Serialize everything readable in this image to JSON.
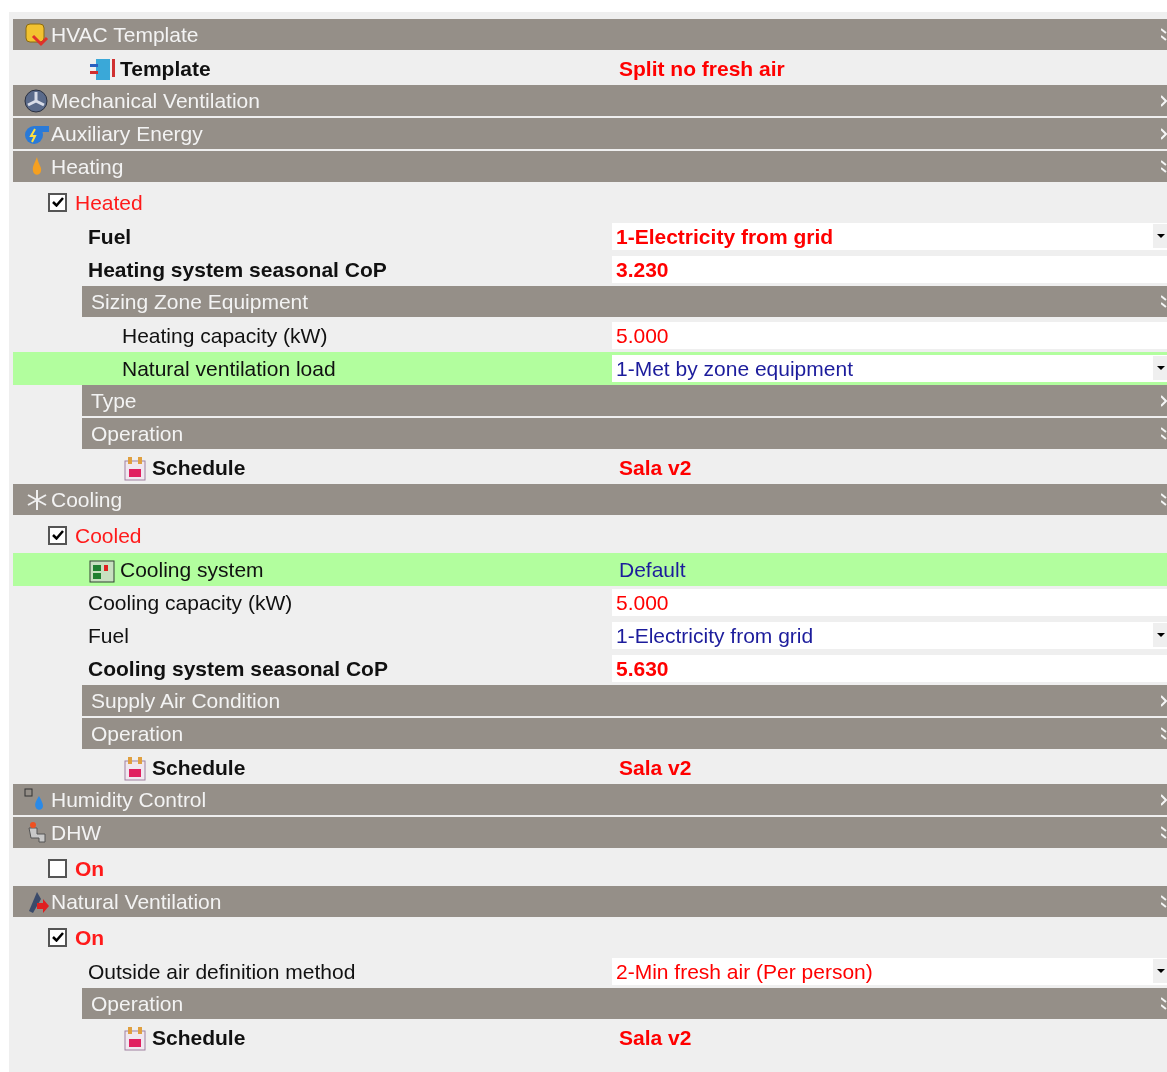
{
  "sections": [
    {
      "title": "HVAC Template",
      "expanded": true,
      "children": [
        {
          "kind": "template",
          "label": "Template",
          "label_bold": true,
          "value": "Split no fresh air",
          "value_bold": true,
          "overridden": true,
          "highlighted": false
        }
      ]
    },
    {
      "title": "Mechanical Ventilation",
      "expanded": false
    },
    {
      "title": "Auxiliary Energy",
      "expanded": false
    },
    {
      "title": "Heating",
      "expanded": true,
      "children": [
        {
          "kind": "checkbox",
          "label": "Heated",
          "checked": true,
          "label_bold": false
        },
        {
          "kind": "dropdown",
          "label": "Fuel",
          "label_bold": true,
          "value": "1-Electricity from grid",
          "value_bold": true,
          "overridden": true,
          "highlighted": false
        },
        {
          "kind": "field",
          "label": "Heating system seasonal CoP",
          "label_bold": true,
          "value": "3.230",
          "value_bold": true,
          "overridden": true,
          "highlighted": false
        },
        {
          "kind": "section",
          "title": "Sizing Zone Equipment",
          "expanded": true,
          "children": [
            {
              "kind": "field",
              "label": "Heating capacity (kW)",
              "label_bold": false,
              "value": "5.000",
              "value_bold": false,
              "overridden": true,
              "highlighted": false
            },
            {
              "kind": "dropdown",
              "label": "Natural ventilation load",
              "label_bold": false,
              "value": "1-Met by zone equipment",
              "value_bold": false,
              "overridden": false,
              "highlighted": true
            }
          ]
        },
        {
          "kind": "section",
          "title": "Type",
          "expanded": false
        },
        {
          "kind": "section",
          "title": "Operation",
          "expanded": true,
          "children": [
            {
              "kind": "schedule",
              "label": "Schedule",
              "label_bold": true,
              "value": "Sala v2",
              "value_bold": true,
              "overridden": true,
              "highlighted": false
            }
          ]
        }
      ]
    },
    {
      "title": "Cooling",
      "expanded": true,
      "children": [
        {
          "kind": "checkbox",
          "label": "Cooled",
          "checked": true,
          "label_bold": false
        },
        {
          "kind": "system",
          "label": "Cooling system",
          "label_bold": false,
          "value": "Default",
          "value_bold": false,
          "overridden": false,
          "highlighted": true
        },
        {
          "kind": "field",
          "label": "Cooling capacity (kW)",
          "label_bold": false,
          "value": "5.000",
          "value_bold": false,
          "overridden": true,
          "highlighted": false
        },
        {
          "kind": "dropdown",
          "label": "Fuel",
          "label_bold": false,
          "value": "1-Electricity from grid",
          "value_bold": false,
          "overridden": false,
          "highlighted": false
        },
        {
          "kind": "field",
          "label": "Cooling system seasonal CoP",
          "label_bold": true,
          "value": "5.630",
          "value_bold": true,
          "overridden": true,
          "highlighted": false
        },
        {
          "kind": "section",
          "title": "Supply Air Condition",
          "expanded": false
        },
        {
          "kind": "section",
          "title": "Operation",
          "expanded": true,
          "children": [
            {
              "kind": "schedule",
              "label": "Schedule",
              "label_bold": true,
              "value": "Sala v2",
              "value_bold": true,
              "overridden": true,
              "highlighted": false
            }
          ]
        }
      ]
    },
    {
      "title": "Humidity Control",
      "expanded": false
    },
    {
      "title": "DHW",
      "expanded": true,
      "children": [
        {
          "kind": "checkbox",
          "label": "On",
          "checked": false,
          "label_bold": true
        }
      ]
    },
    {
      "title": "Natural Ventilation",
      "expanded": true,
      "children": [
        {
          "kind": "checkbox",
          "label": "On",
          "checked": true,
          "label_bold": true
        },
        {
          "kind": "dropdown",
          "label": "Outside air definition method",
          "label_bold": false,
          "value": "2-Min fresh air (Per person)",
          "value_bold": false,
          "overridden": true,
          "highlighted": false
        },
        {
          "kind": "section",
          "title": "Operation",
          "expanded": true,
          "children": [
            {
              "kind": "schedule",
              "label": "Schedule",
              "label_bold": true,
              "value": "Sala v2",
              "value_bold": true,
              "overridden": true,
              "highlighted": false
            }
          ]
        }
      ]
    }
  ]
}
